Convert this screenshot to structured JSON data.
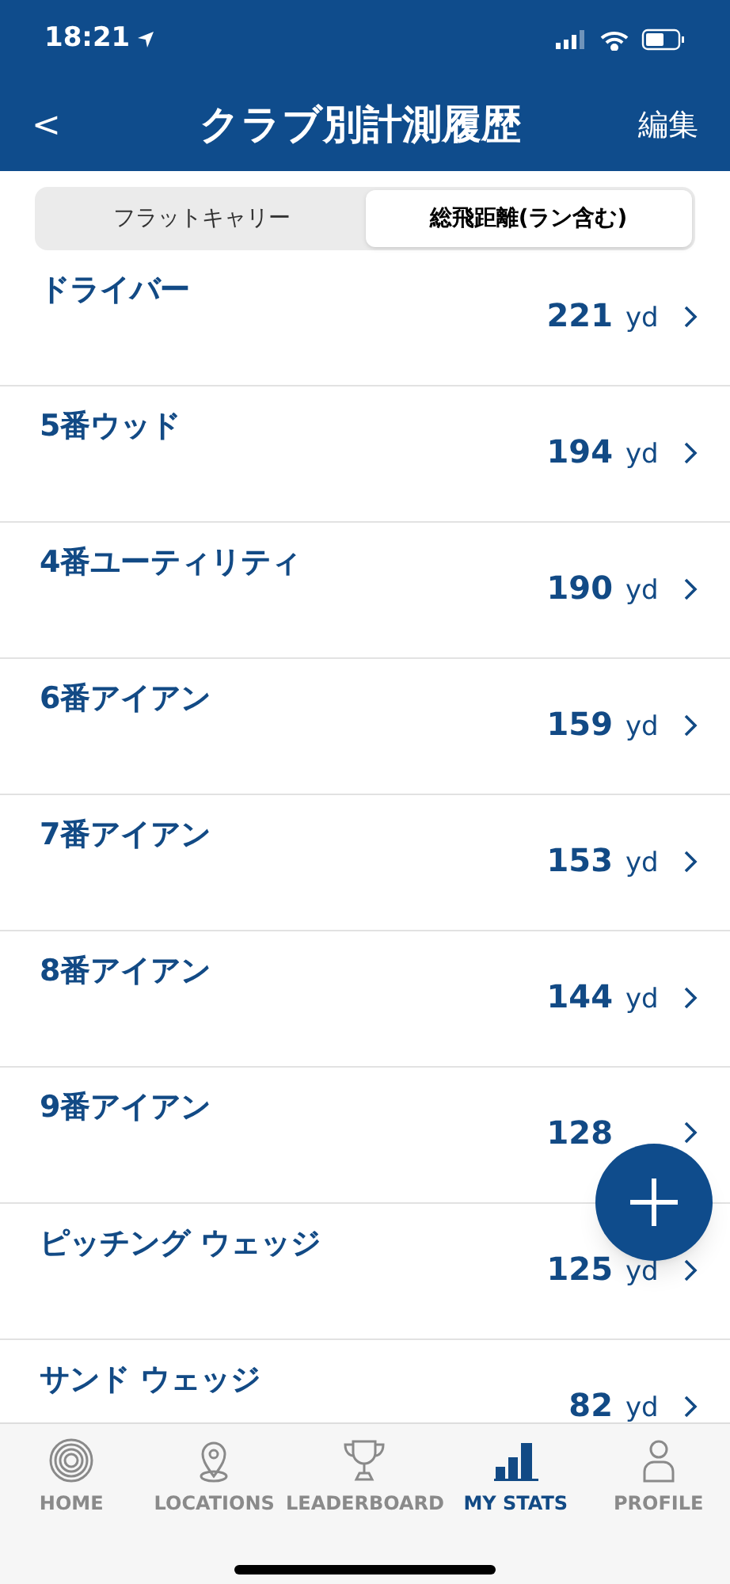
{
  "status_bar": {
    "time": "18:21"
  },
  "nav": {
    "back": "<",
    "title": "クラブ別計測履歴",
    "action": "編集"
  },
  "segments": [
    {
      "label": "フラットキャリー",
      "selected": false
    },
    {
      "label": "総飛距離(ラン含む)",
      "selected": true
    }
  ],
  "clubs": [
    {
      "name": "ドライバー",
      "value": "221",
      "unit": "yd"
    },
    {
      "name": "5番ウッド",
      "value": "194",
      "unit": "yd"
    },
    {
      "name": "4番ユーティリティ",
      "value": "190",
      "unit": "yd"
    },
    {
      "name": "6番アイアン",
      "value": "159",
      "unit": "yd"
    },
    {
      "name": "7番アイアン",
      "value": "153",
      "unit": "yd"
    },
    {
      "name": "8番アイアン",
      "value": "144",
      "unit": "yd"
    },
    {
      "name": "9番アイアン",
      "value": "128"
    },
    {
      "name": "ピッチング ウェッジ",
      "value": "125",
      "unit": "yd"
    },
    {
      "name": "サンド ウェッジ",
      "value": "82",
      "unit": "yd"
    }
  ],
  "tab_bar": [
    {
      "label": "HOME",
      "kind": "rings",
      "selected": false
    },
    {
      "label": "LOCATIONS",
      "kind": "pin",
      "selected": false
    },
    {
      "label": "LEADERBOARD",
      "kind": "trophy",
      "selected": false
    },
    {
      "label": "MY STATS",
      "kind": "bars",
      "selected": true
    },
    {
      "label": "PROFILE",
      "kind": "person",
      "selected": false
    }
  ]
}
